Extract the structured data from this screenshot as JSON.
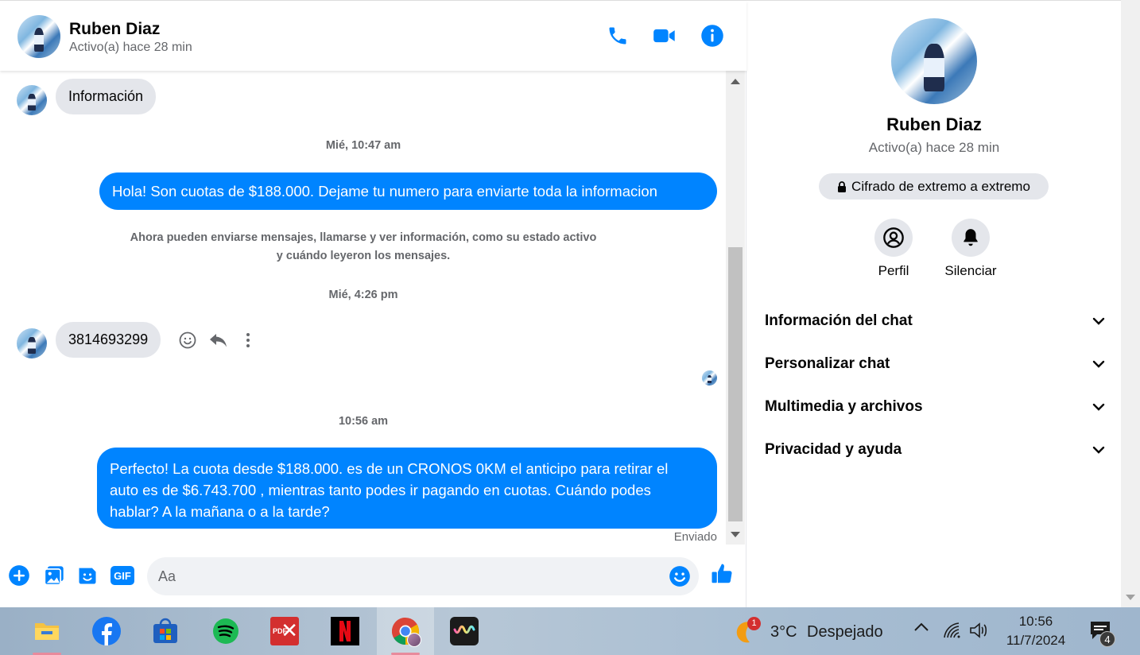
{
  "header": {
    "name": "Ruben Diaz",
    "status": "Activo(a) hace 28 min"
  },
  "messages": {
    "first_in": "Información",
    "ts1": "Mié, 10:47 am",
    "out1": "Hola! Son cuotas de $188.000. Dejame tu numero para enviarte toda la informacion",
    "system_line1": "Ahora pueden enviarse mensajes, llamarse y ver información, como su estado activo",
    "system_line2": "y cuándo leyeron los mensajes.",
    "ts2": "Mié, 4:26 pm",
    "in_phone": "3814693299",
    "ts3": "10:56 am",
    "out2_line1": "Perfecto! La cuota desde $188.000. es de un CRONOS 0KM el anticipo para retirar el",
    "out2_line2": "auto es de $6.743.700 , mientras tanto podes ir pagando en cuotas. Cuándo podes",
    "out2_line3": "hablar? A la mañana o a la tarde?",
    "sent_label": "Enviado"
  },
  "composer": {
    "placeholder": "Aa",
    "gif_label": "GIF"
  },
  "info": {
    "name": "Ruben Diaz",
    "status": "Activo(a) hace 28 min",
    "e2e": "Cifrado de extremo a extremo",
    "actions": [
      "Perfil",
      "Silenciar"
    ],
    "sections": [
      "Información del chat",
      "Personalizar chat",
      "Multimedia y archivos",
      "Privacidad y ayuda"
    ]
  },
  "taskbar": {
    "weather_badge": "1",
    "temperature": "3°C",
    "weather": "Despejado",
    "time": "10:56",
    "date": "11/7/2024",
    "notif_count": "4",
    "pdf_label": "PDF"
  },
  "colors": {
    "messenger_blue": "#0084ff",
    "bubble_gray": "#e4e6eb"
  }
}
